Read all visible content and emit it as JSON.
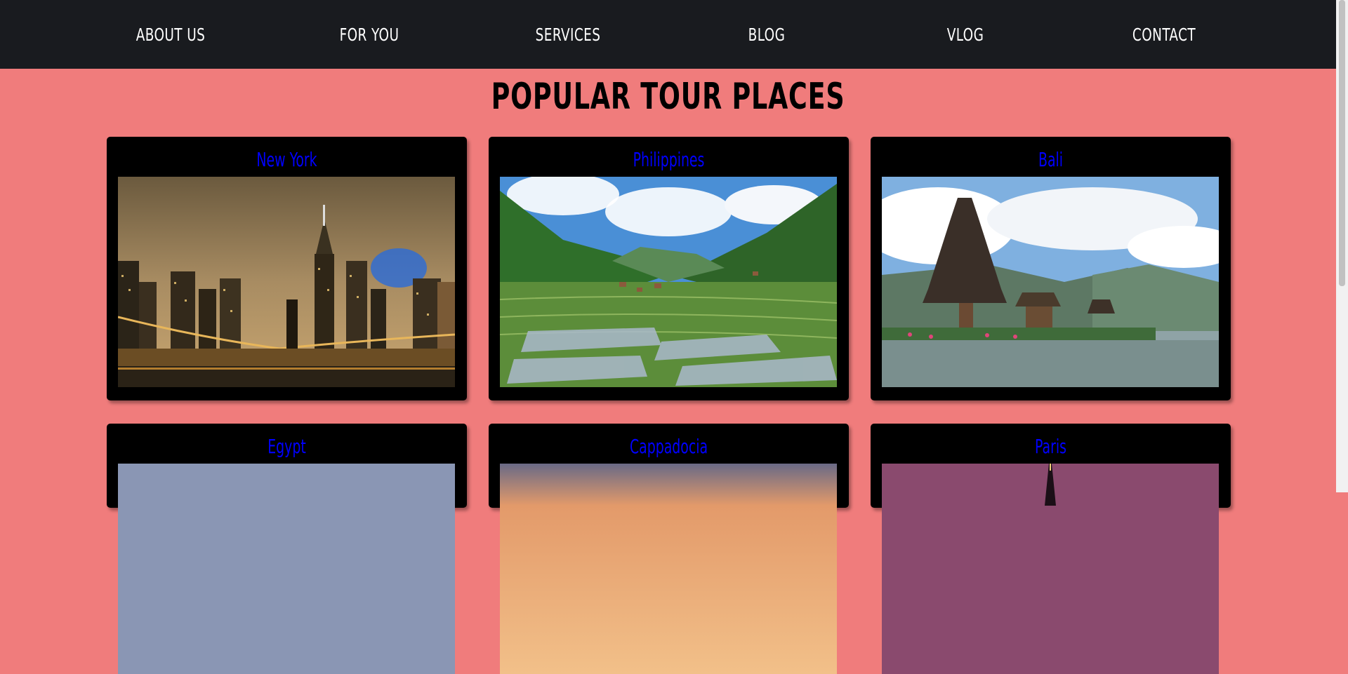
{
  "nav": {
    "items": [
      {
        "label": "ABOUT US"
      },
      {
        "label": "FOR YOU"
      },
      {
        "label": "SERVICES"
      },
      {
        "label": "BLOG"
      },
      {
        "label": "VLOG"
      },
      {
        "label": "CONTACT"
      }
    ]
  },
  "main": {
    "title": "POPULAR TOUR PLACES",
    "places": [
      {
        "name": "New York"
      },
      {
        "name": "Philippines"
      },
      {
        "name": "Bali"
      },
      {
        "name": "Egypt"
      },
      {
        "name": "Cappadocia"
      },
      {
        "name": "Paris"
      }
    ]
  },
  "colors": {
    "background": "#f07c7c",
    "nav_background": "#191b1f",
    "card_background": "#000000",
    "link": "#0000ff"
  }
}
